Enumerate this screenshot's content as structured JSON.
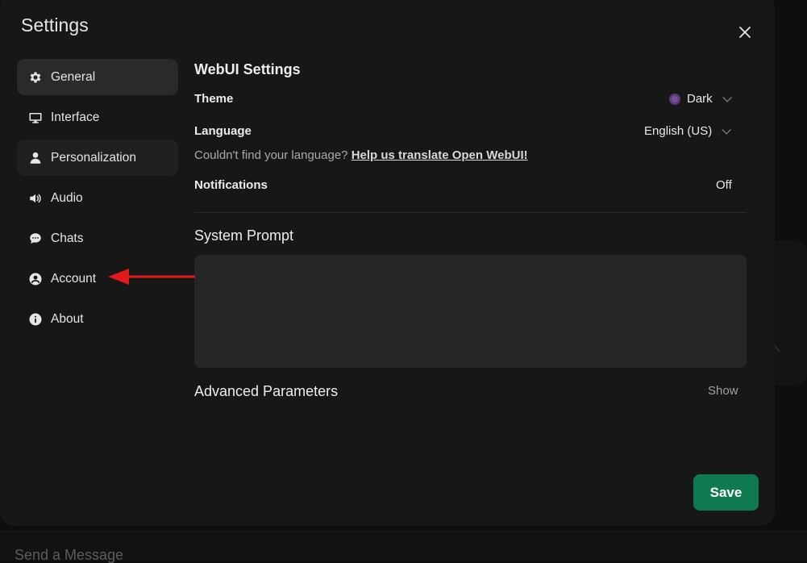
{
  "settings": {
    "title": "Settings",
    "close_icon": "close-icon"
  },
  "sidebar": {
    "items": [
      {
        "label": "General",
        "icon": "gear-icon",
        "state": "active"
      },
      {
        "label": "Interface",
        "icon": "monitor-icon",
        "state": "normal"
      },
      {
        "label": "Personalization",
        "icon": "user-icon",
        "state": "hover"
      },
      {
        "label": "Audio",
        "icon": "speaker-icon",
        "state": "normal"
      },
      {
        "label": "Chats",
        "icon": "chat-bubble-icon",
        "state": "normal"
      },
      {
        "label": "Account",
        "icon": "user-circle-icon",
        "state": "normal"
      },
      {
        "label": "About",
        "icon": "info-icon",
        "state": "normal"
      }
    ]
  },
  "general": {
    "section_title": "WebUI Settings",
    "theme": {
      "label": "Theme",
      "value": "Dark"
    },
    "language": {
      "label": "Language",
      "value": "English (US)"
    },
    "language_hint": {
      "text": "Couldn't find your language?",
      "link": "Help us translate Open WebUI!"
    },
    "notifications": {
      "label": "Notifications",
      "value": "Off"
    },
    "system_prompt": {
      "title": "System Prompt",
      "value": ""
    },
    "advanced": {
      "title": "Advanced Parameters",
      "toggle": "Show"
    },
    "save_label": "Save"
  },
  "composer": {
    "placeholder": "Send a Message"
  },
  "colors": {
    "accent_save": "#0f7a4f",
    "annotation_arrow": "#e01b1b",
    "modal_bg": "#171717",
    "active_item_bg": "#2a2a2a"
  }
}
